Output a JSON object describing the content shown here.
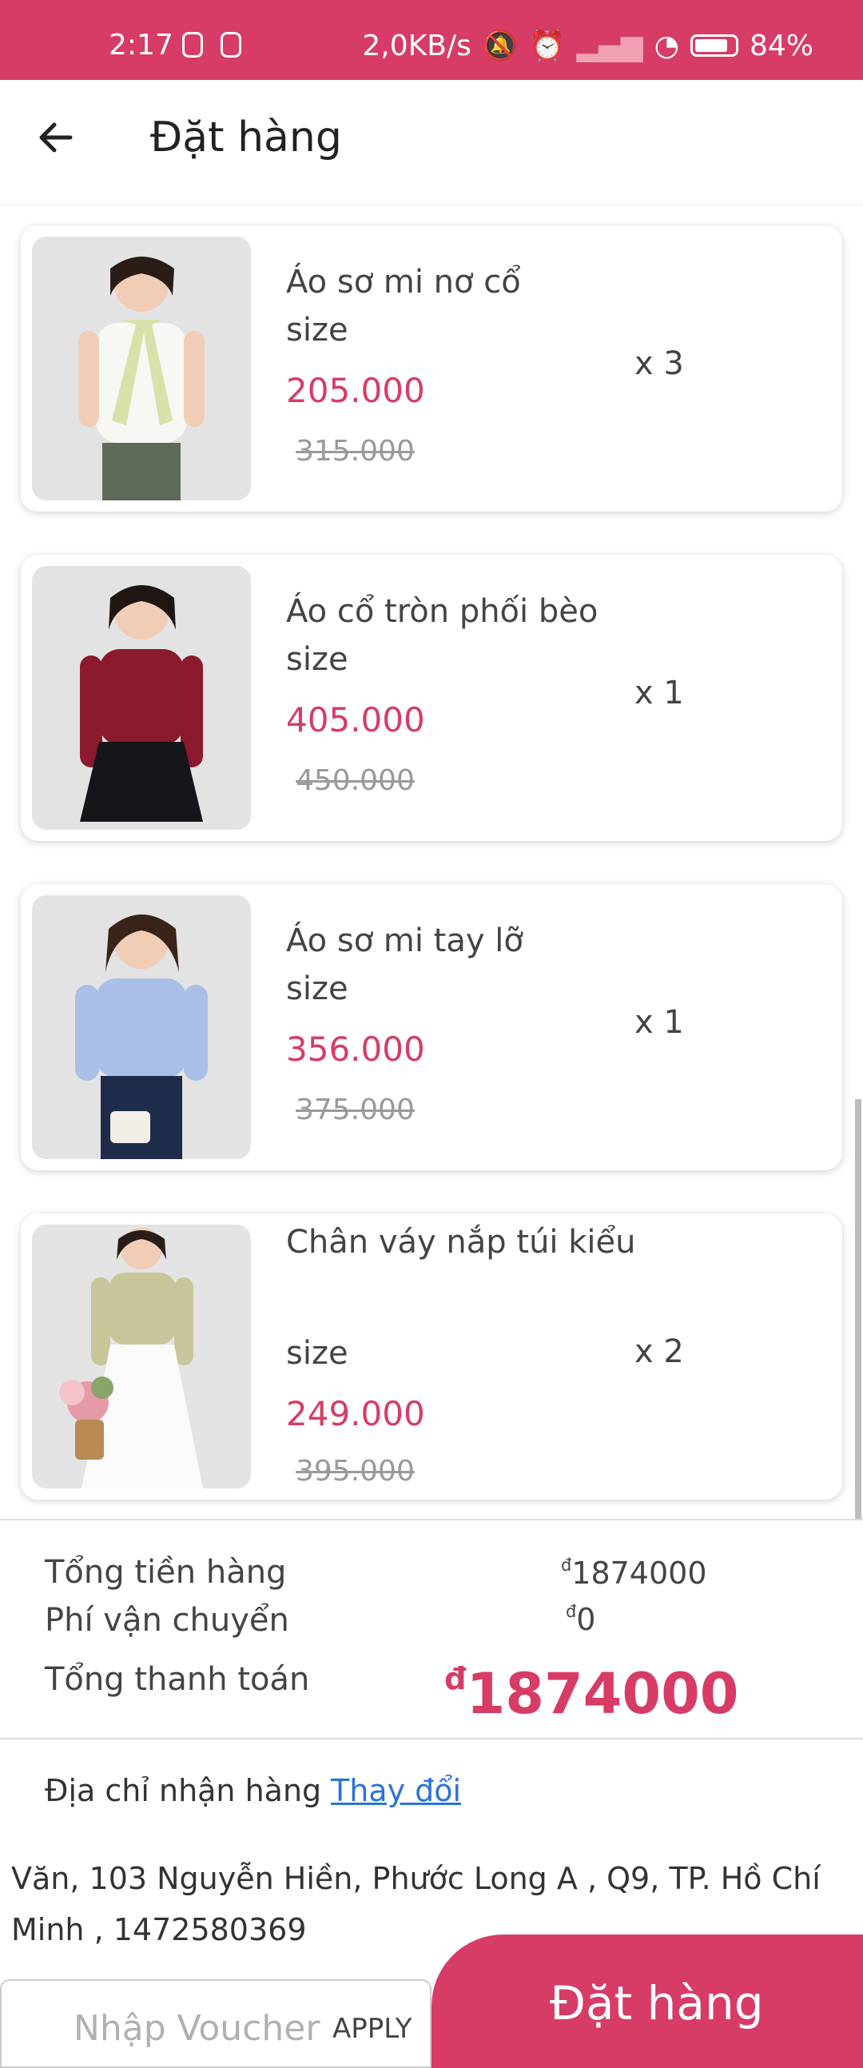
{
  "status_bar": {
    "time": "2:17",
    "net_speed": "2,0KB/s",
    "battery": "84%"
  },
  "header": {
    "title": "Đặt hàng"
  },
  "items": [
    {
      "name": "Áo sơ mi nơ cổ",
      "size_label": "size",
      "price": "205.000",
      "old_price": "315.000",
      "qty": "x 3"
    },
    {
      "name": "Áo cổ tròn phối bèo",
      "size_label": "size",
      "price": "405.000",
      "old_price": "450.000",
      "qty": "x 1"
    },
    {
      "name": "Áo sơ mi tay lỡ",
      "size_label": "size",
      "price": "356.000",
      "old_price": "375.000",
      "qty": "x 1"
    },
    {
      "name": "Chân váy nắp túi kiểu",
      "size_label": "size",
      "price": "249.000",
      "old_price": "395.000",
      "qty": "x 2"
    }
  ],
  "summary": {
    "subtotal_label": "Tổng tiền hàng",
    "subtotal_value": "1874000",
    "shipping_label": "Phí vận chuyển",
    "shipping_value": "0",
    "total_label": "Tổng thanh toán",
    "total_value": "1874000",
    "currency": "đ"
  },
  "address": {
    "label": "Địa chỉ nhận hàng",
    "change_label": "Thay đổi",
    "text": "Văn, 103 Nguyễn Hiền, Phước Long A , Q9, TP. Hồ Chí Minh , 1472580369"
  },
  "footer": {
    "voucher_placeholder": "Nhập Voucher",
    "apply_label": "APPLY",
    "order_label": "Đặt hàng"
  },
  "colors": {
    "accent": "#d63c66",
    "link": "#2a73d9"
  }
}
